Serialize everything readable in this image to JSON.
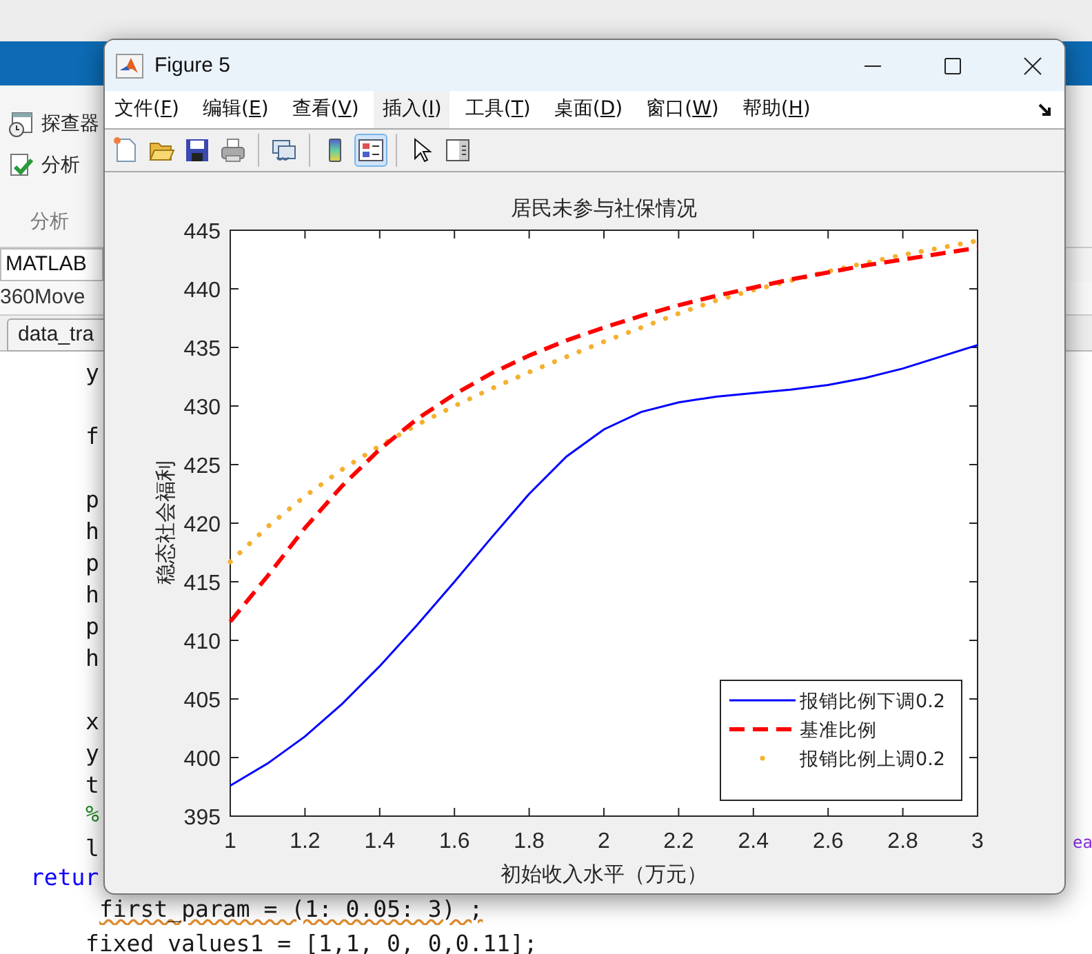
{
  "background_window": {
    "toolstrip": [
      {
        "label": "探查器",
        "kind": "explorer"
      },
      {
        "label": "分析",
        "kind": "analyze"
      }
    ],
    "section_label": "分析",
    "address": "MATLAB",
    "folder": "360Move",
    "editor_tab": "data_tra",
    "code_lines": [
      {
        "kind": "code",
        "text": "y"
      },
      {
        "kind": "blank"
      },
      {
        "kind": "code",
        "text": "f"
      },
      {
        "kind": "blank"
      },
      {
        "kind": "code",
        "text": "p"
      },
      {
        "kind": "code",
        "text": "h"
      },
      {
        "kind": "code",
        "text": "p"
      },
      {
        "kind": "code",
        "text": "h"
      },
      {
        "kind": "code",
        "text": "p"
      },
      {
        "kind": "code",
        "text": "h"
      },
      {
        "kind": "blank"
      },
      {
        "kind": "code",
        "text": "x"
      },
      {
        "kind": "code",
        "text": "y"
      },
      {
        "kind": "code",
        "text": "t"
      },
      {
        "kind": "comment",
        "text": "%"
      },
      {
        "kind": "code",
        "text": "l"
      },
      {
        "kind": "keyword",
        "text": "retur"
      },
      {
        "kind": "flagged",
        "text": "first_param = (1: 0.05: 3) ;"
      },
      {
        "kind": "code",
        "text": "fixed_values1 = [1,1, 0, 0,0.11];"
      }
    ],
    "side_text": "ea"
  },
  "figure": {
    "title": "Figure 5",
    "menu": [
      {
        "label": "文件(F)",
        "highlighted": false
      },
      {
        "label": "编辑(E)",
        "highlighted": false
      },
      {
        "label": "查看(V)",
        "highlighted": false
      },
      {
        "label": "插入(I)",
        "highlighted": true
      },
      {
        "label": "工具(T)",
        "highlighted": false
      },
      {
        "label": "桌面(D)",
        "highlighted": false
      },
      {
        "label": "窗口(W)",
        "highlighted": false
      },
      {
        "label": "帮助(H)",
        "highlighted": false
      }
    ],
    "toolbar": [
      {
        "kind": "new",
        "pressed": false
      },
      {
        "kind": "open",
        "pressed": false
      },
      {
        "kind": "save",
        "pressed": false
      },
      {
        "kind": "print",
        "pressed": false
      },
      {
        "kind": "separator"
      },
      {
        "kind": "link",
        "pressed": false
      },
      {
        "kind": "separator"
      },
      {
        "kind": "colorbar",
        "pressed": false
      },
      {
        "kind": "legend",
        "pressed": true
      },
      {
        "kind": "separator"
      },
      {
        "kind": "pointer",
        "pressed": false
      },
      {
        "kind": "inspector",
        "pressed": false
      }
    ],
    "chart_data": {
      "type": "line",
      "title": "居民未参与社保情况",
      "xlabel": "初始收入水平（万元）",
      "ylabel": "稳态社会福利",
      "x": [
        1,
        1.1,
        1.2,
        1.3,
        1.4,
        1.5,
        1.6,
        1.7,
        1.8,
        1.9,
        2,
        2.1,
        2.2,
        2.3,
        2.4,
        2.5,
        2.6,
        2.7,
        2.8,
        2.9,
        3
      ],
      "series": [
        {
          "name": "报销比例下调0.2",
          "color": "#0000ff",
          "line_style": "solid",
          "values": [
            397.6,
            399.5,
            401.8,
            404.6,
            407.8,
            411.3,
            415.0,
            418.8,
            422.5,
            425.7,
            428.0,
            429.5,
            430.3,
            430.8,
            431.1,
            431.4,
            431.8,
            432.4,
            433.2,
            434.2,
            435.2
          ]
        },
        {
          "name": "基准比例",
          "color": "#ff0000",
          "line_style": "dashed",
          "values": [
            411.6,
            415.5,
            419.6,
            423.2,
            426.3,
            428.9,
            431.0,
            432.8,
            434.3,
            435.6,
            436.7,
            437.7,
            438.6,
            439.4,
            440.1,
            440.8,
            441.4,
            442.0,
            442.5,
            443.0,
            443.5
          ]
        },
        {
          "name": "报销比例上调0.2",
          "color": "#f5b030",
          "line_style": "dotted",
          "values": [
            416.7,
            419.7,
            422.3,
            424.6,
            426.6,
            428.4,
            430.0,
            431.5,
            432.9,
            434.2,
            435.5,
            436.7,
            437.9,
            439.0,
            439.9,
            440.7,
            441.5,
            442.2,
            442.9,
            443.5,
            444.1
          ]
        }
      ],
      "xlim": [
        1,
        3
      ],
      "ylim": [
        395,
        445
      ],
      "xticks": [
        1,
        1.2,
        1.4,
        1.6,
        1.8,
        2,
        2.2,
        2.4,
        2.6,
        2.8,
        3
      ],
      "yticks": [
        395,
        400,
        405,
        410,
        415,
        420,
        425,
        430,
        435,
        440,
        445
      ],
      "legend": "lower right"
    }
  }
}
